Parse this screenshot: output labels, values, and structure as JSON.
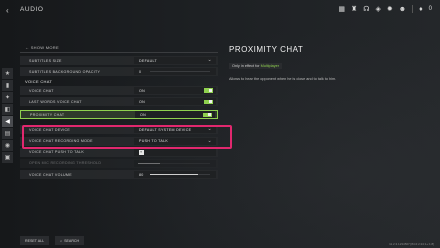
{
  "header": {
    "back_icon": "‹",
    "title": "AUDIO",
    "icons": [
      "grid-icon",
      "trophy-icon",
      "headset-icon",
      "notification-icon",
      "settings-icon",
      "friends-icon",
      "mic-icon"
    ],
    "notif_count": "0"
  },
  "rail": [
    "★",
    "▮",
    "✦",
    "◧",
    "◀",
    "▤",
    "◉",
    "▣"
  ],
  "settings": {
    "show_more": "← SHOW MORE",
    "subtitle_size": {
      "label": "SUBTITLES SIZE",
      "value": "DEFAULT"
    },
    "subtitle_bg": {
      "label": "SUBTITLES BACKGROUND OPACITY",
      "value": "0",
      "level": 0.0
    },
    "voice_section": "VOICE CHAT",
    "voice_chat": {
      "label": "VOICE CHAT",
      "value": "ON"
    },
    "last_words": {
      "label": "LAST WORDS VOICE CHAT",
      "value": "ON"
    },
    "proximity": {
      "label": "PROXIMITY CHAT",
      "value": "ON"
    },
    "device": {
      "label": "VOICE CHAT DEVICE",
      "value": "DEFAULT SYSTEM DEVICE"
    },
    "recording": {
      "label": "VOICE CHAT RECORDING MODE",
      "value": "PUSH TO TALK"
    },
    "push_key": {
      "label": "VOICE CHAT PUSH TO TALK",
      "value": "T"
    },
    "threshold": {
      "label": "OPEN MIC RECORDING THRESHOLD",
      "value": "",
      "level": 0.3
    },
    "volume": {
      "label": "VOICE CHAT VOLUME",
      "value": "80",
      "level": 0.8
    }
  },
  "panel": {
    "title": "PROXIMITY CHAT",
    "note_prefix": "Only in effect for",
    "note_mode": "Multiplayer",
    "desc": "Allows to hear the opponent when he is close and to talk to him."
  },
  "bottom": {
    "reset": "RESET ALL",
    "search": "SEARCH"
  },
  "footer": "11.2.3.1234567 [84:2:2:24:1+:1:8]"
}
